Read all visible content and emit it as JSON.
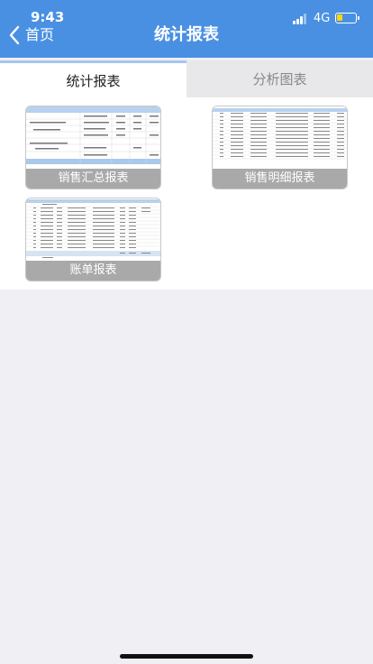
{
  "status_bar": {
    "time": "9:43",
    "network": "4G"
  },
  "nav": {
    "back_label": "首页",
    "title": "统计报表"
  },
  "tabs": [
    {
      "label": "统计报表",
      "active": true
    },
    {
      "label": "分析图表",
      "active": false
    }
  ],
  "reports": [
    {
      "label": "销售汇总报表"
    },
    {
      "label": "销售明细报表"
    },
    {
      "label": "账单报表"
    }
  ],
  "colors": {
    "accent": "#4a90e2",
    "caption_bg": "#a9a9a9",
    "tab_indicator": "#a7c4ef"
  }
}
